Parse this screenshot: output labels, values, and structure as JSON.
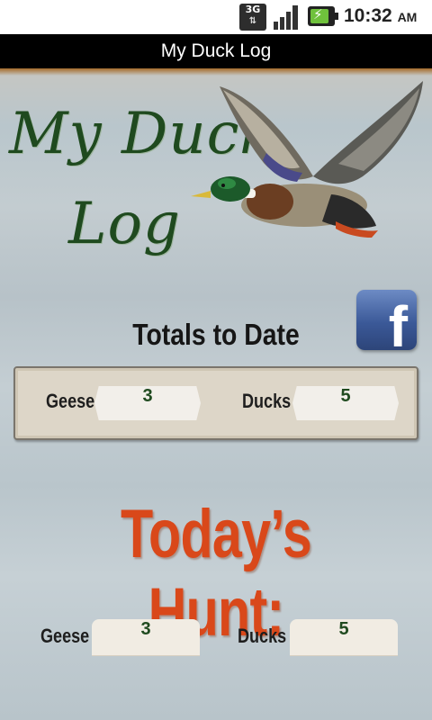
{
  "status_bar": {
    "network_type": "3G",
    "network_icon": "3g-data-icon",
    "signal_icon": "signal-strength-icon",
    "battery_icon": "battery-charging-icon",
    "time": "10:32",
    "ampm": "AM"
  },
  "app": {
    "title": "My Duck Log"
  },
  "logo": {
    "line1": "My Duck",
    "line2": "Log",
    "color": "#1f4a1f"
  },
  "facebook": {
    "glyph": "f",
    "color": "#3b5998"
  },
  "totals": {
    "heading": "Totals to Date",
    "geese_label": "Geese",
    "geese_value": "3",
    "ducks_label": "Ducks",
    "ducks_value": "5"
  },
  "today": {
    "heading": "Today’s Hunt:",
    "heading_color": "#d9481a",
    "geese_label": "Geese",
    "geese_value": "3",
    "ducks_label": "Ducks",
    "ducks_value": "5"
  }
}
